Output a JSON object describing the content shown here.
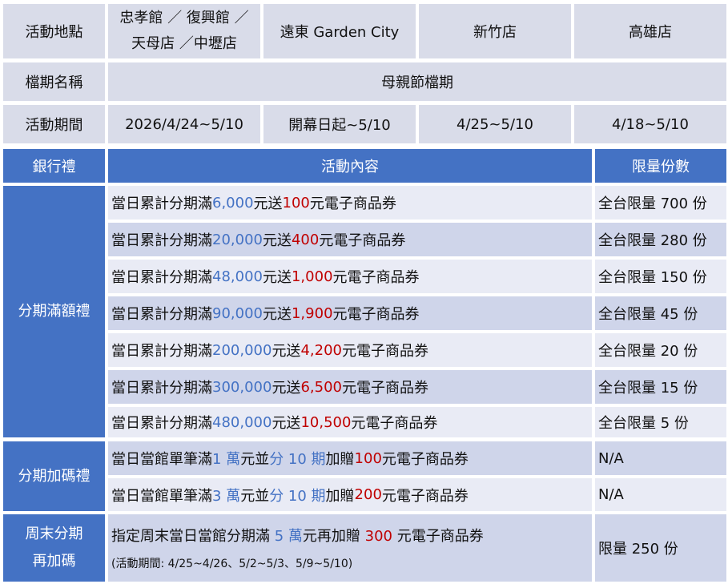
{
  "header": {
    "location_label": "活動地點",
    "locations": [
      "忠孝館 ／ 復興館 ／",
      "天母店 ／中壢店",
      "遠東 Garden City",
      "新竹店",
      "高雄店"
    ],
    "period_name_label": "檔期名稱",
    "period_name": "母親節檔期",
    "period_label": "活動期間",
    "periods": [
      "2026/4/24~5/10",
      "開幕日起~5/10",
      "4/25~5/10",
      "4/18~5/10"
    ]
  },
  "table": {
    "col_gift": "銀行禮",
    "col_content": "活動內容",
    "col_limit": "限量份數",
    "groups": {
      "installment_threshold": "分期滿額禮",
      "installment_bonus": "分期加碼禮",
      "weekend_line1": "周末分期",
      "weekend_line2": "再加碼"
    },
    "rows": [
      {
        "prefix": "當日累計分期滿 ",
        "amount": "6,000",
        "mid": " 元送 ",
        "voucher": "100",
        "suffix": " 元電子商品券",
        "limit": "全台限量 700 份"
      },
      {
        "prefix": "當日累計分期滿 ",
        "amount": "20,000",
        "mid": " 元送 ",
        "voucher": "400",
        "suffix": " 元電子商品券",
        "limit": "全台限量 280 份"
      },
      {
        "prefix": "當日累計分期滿 ",
        "amount": "48,000",
        "mid": " 元送 ",
        "voucher": "1,000",
        "suffix": " 元電子商品券",
        "limit": "全台限量 150 份"
      },
      {
        "prefix": "當日累計分期滿 ",
        "amount": "90,000",
        "mid": " 元送 ",
        "voucher": "1,900",
        "suffix": " 元電子商品券",
        "limit": "全台限量 45 份"
      },
      {
        "prefix": "當日累計分期滿 ",
        "amount": "200,000",
        "mid": " 元送 ",
        "voucher": "4,200",
        "suffix": " 元電子商品券",
        "limit": "全台限量 20 份"
      },
      {
        "prefix": "當日累計分期滿 ",
        "amount": "300,000",
        "mid": " 元送 ",
        "voucher": "6,500",
        "suffix": " 元電子商品券",
        "limit": "全台限量 15 份"
      },
      {
        "prefix": "當日累計分期滿 ",
        "amount": "480,000",
        "mid": " 元送 ",
        "voucher": "10,500",
        "suffix": " 元電子商品券",
        "limit": "全台限量 5 份"
      }
    ],
    "bonus_rows": [
      {
        "prefix": "當日當館單筆滿 ",
        "amount": "1 萬",
        "mid": "元並",
        "installments": "分 10 期",
        "gift": "加贈 ",
        "voucher": "100",
        "suffix": " 元電子商品券",
        "limit": "N/A"
      },
      {
        "prefix": "當日當館單筆滿 ",
        "amount": "3 萬",
        "mid": "元並",
        "installments": "分 10 期",
        "gift": "加贈 ",
        "voucher": "200",
        "suffix": " 元電子商品券",
        "limit": "N/A"
      }
    ],
    "weekend": {
      "prefix": "指定周末當日當館分期滿 ",
      "amount": "5 萬",
      "mid": "元再加贈 ",
      "voucher": "300",
      "suffix": " 元電子商品券",
      "note": "(活動期間: 4/25~4/26、5/2~5/3、5/9~5/10)",
      "limit": "限量 250 份"
    }
  },
  "colors": {
    "header_blue": "#4472c4",
    "amount_blue": "#4472c4",
    "voucher_red": "#c00000",
    "pale": "#d9dce9"
  }
}
